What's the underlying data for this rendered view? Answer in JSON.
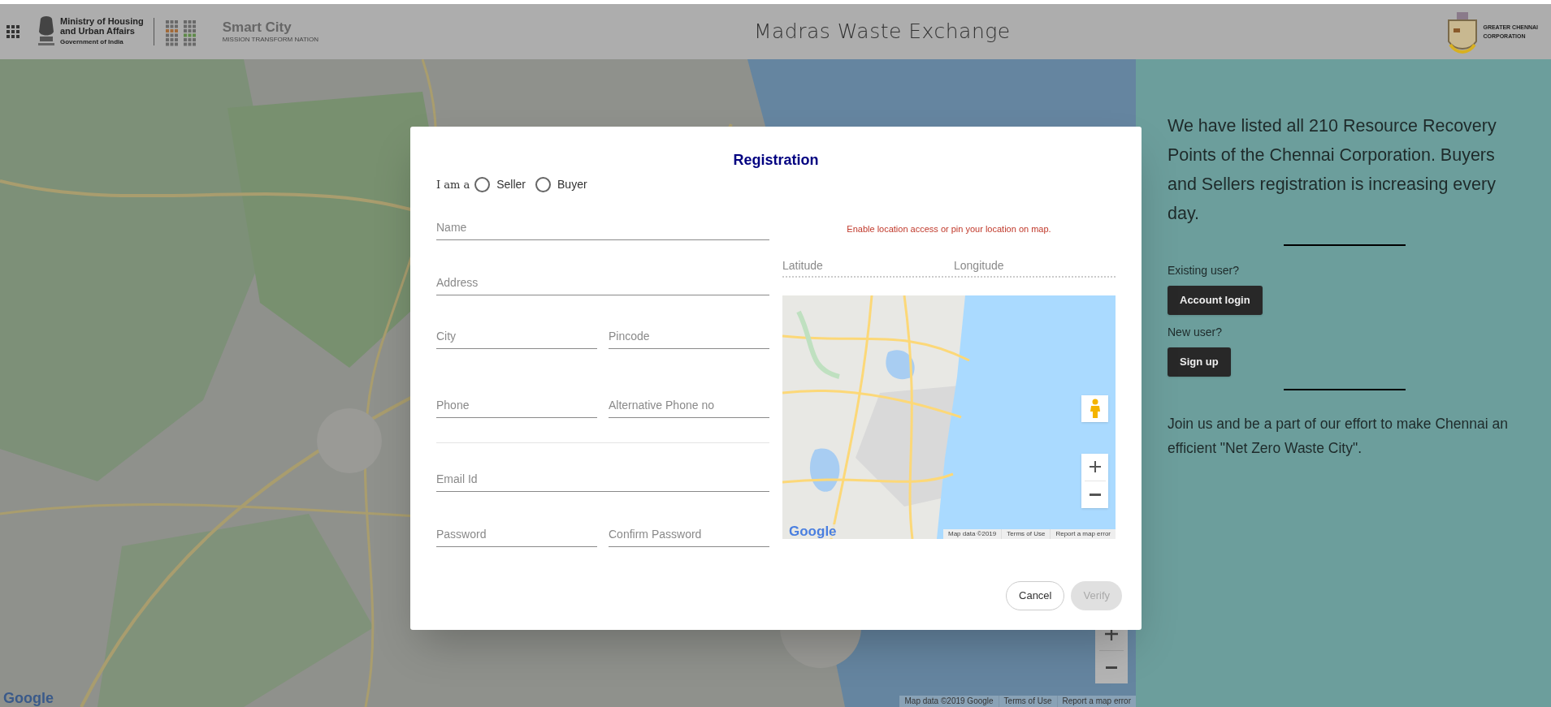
{
  "header": {
    "ministry": {
      "name_lines": [
        "Ministry of Housing",
        "and Urban Affairs"
      ],
      "subtitle": "Government of India"
    },
    "smart_city": {
      "name": "Smart City",
      "tagline": "MISSION TRANSFORM NATION"
    },
    "title": "Madras Waste Exchange",
    "corporation": {
      "name_lines": [
        "GREATER CHENNAI",
        "CORPORATION"
      ]
    }
  },
  "background_map": {
    "kind": "picture",
    "logo": "Google",
    "attribution": [
      "Map data ©2019 Google",
      "Terms of Use",
      "Report a map error"
    ]
  },
  "info_panel": {
    "intro": "We have listed all 210 Resource Recovery Points of the Chennai Corporation. Buyers and Sellers registration is increasing every day.",
    "existing_label": "Existing user?",
    "login_button": "Account login",
    "new_label": "New user?",
    "signup_button": "Sign up",
    "outro": "Join us and be a part of our effort to make Chennai an efficient \"Net Zero Waste City\"."
  },
  "registration": {
    "title": "Registration",
    "role_label": "I am a",
    "roles": [
      {
        "label": "Seller",
        "selected": false
      },
      {
        "label": "Buyer",
        "selected": false
      }
    ],
    "rows": [
      {
        "kind": "fields",
        "fields": [
          {
            "placeholder": "Name"
          }
        ]
      },
      {
        "kind": "fields",
        "fields": [
          {
            "placeholder": "Address"
          }
        ]
      },
      {
        "kind": "fields",
        "fields": [
          {
            "placeholder": "City"
          },
          {
            "placeholder": "Pincode"
          }
        ]
      },
      {
        "kind": "fields",
        "fields": [
          {
            "placeholder": "Phone"
          },
          {
            "placeholder": "Alternative Phone no"
          }
        ]
      },
      {
        "kind": "divider"
      },
      {
        "kind": "fields",
        "fields": [
          {
            "placeholder": "Email Id"
          }
        ]
      },
      {
        "kind": "fields",
        "fields": [
          {
            "placeholder": "Password"
          },
          {
            "placeholder": "Confirm Password"
          }
        ]
      }
    ],
    "location_message": "Enable location access or pin your location on map.",
    "coordinates": [
      {
        "placeholder": "Latitude"
      },
      {
        "placeholder": "Longitude"
      }
    ],
    "map": {
      "kind": "picture",
      "logo": "Google",
      "attribution": [
        "Map data ©2019",
        "Terms of Use",
        "Report a map error"
      ]
    },
    "buttons": [
      {
        "label": "Cancel",
        "disabled": false
      },
      {
        "label": "Verify",
        "disabled": true
      }
    ]
  }
}
